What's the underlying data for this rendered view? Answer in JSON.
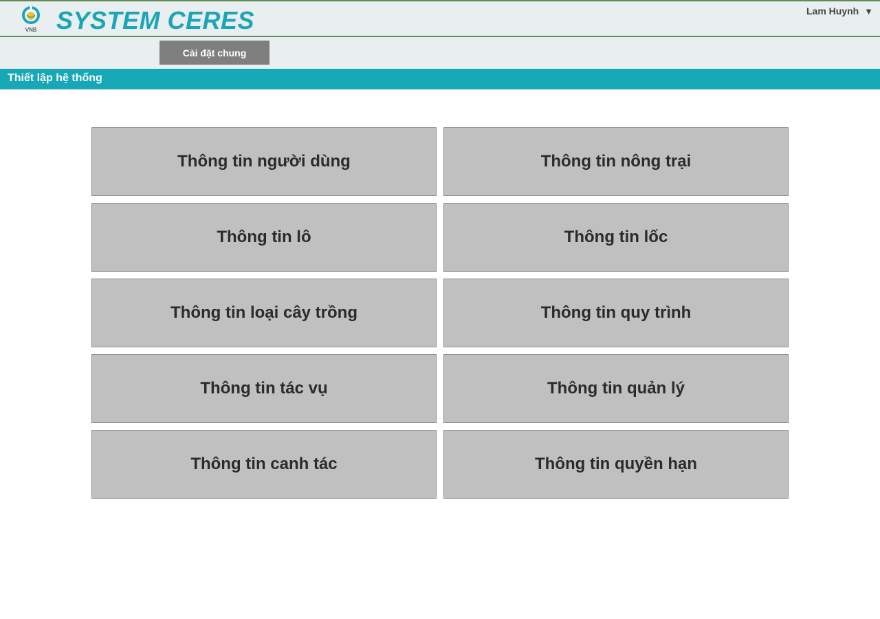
{
  "header": {
    "logo_text": "VNB",
    "brand": "SYSTEM CERES",
    "user_name": "Lam Huynh",
    "user_caret": "▼"
  },
  "nav": {
    "tab_label": "Cài đặt chung"
  },
  "section": {
    "title": "Thiết lập hệ thống"
  },
  "tiles": [
    "Thông tin người dùng",
    "Thông tin nông trại",
    "Thông tin lô",
    "Thông tin lốc",
    "Thông tin loại cây trồng",
    "Thông tin quy trình",
    "Thông tin tác vụ",
    "Thông tin quản lý",
    "Thông tin canh tác",
    "Thông tin quyền hạn"
  ],
  "colors": {
    "accent": "#1aa6b7",
    "section_bar": "#17a8b8",
    "header_border": "#5e8a55",
    "tab_bg": "#7f7f7f",
    "tile_bg": "#c0c0c0"
  },
  "icons": {
    "logo": "vnb-logo-icon",
    "user_caret": "caret-down-icon"
  }
}
